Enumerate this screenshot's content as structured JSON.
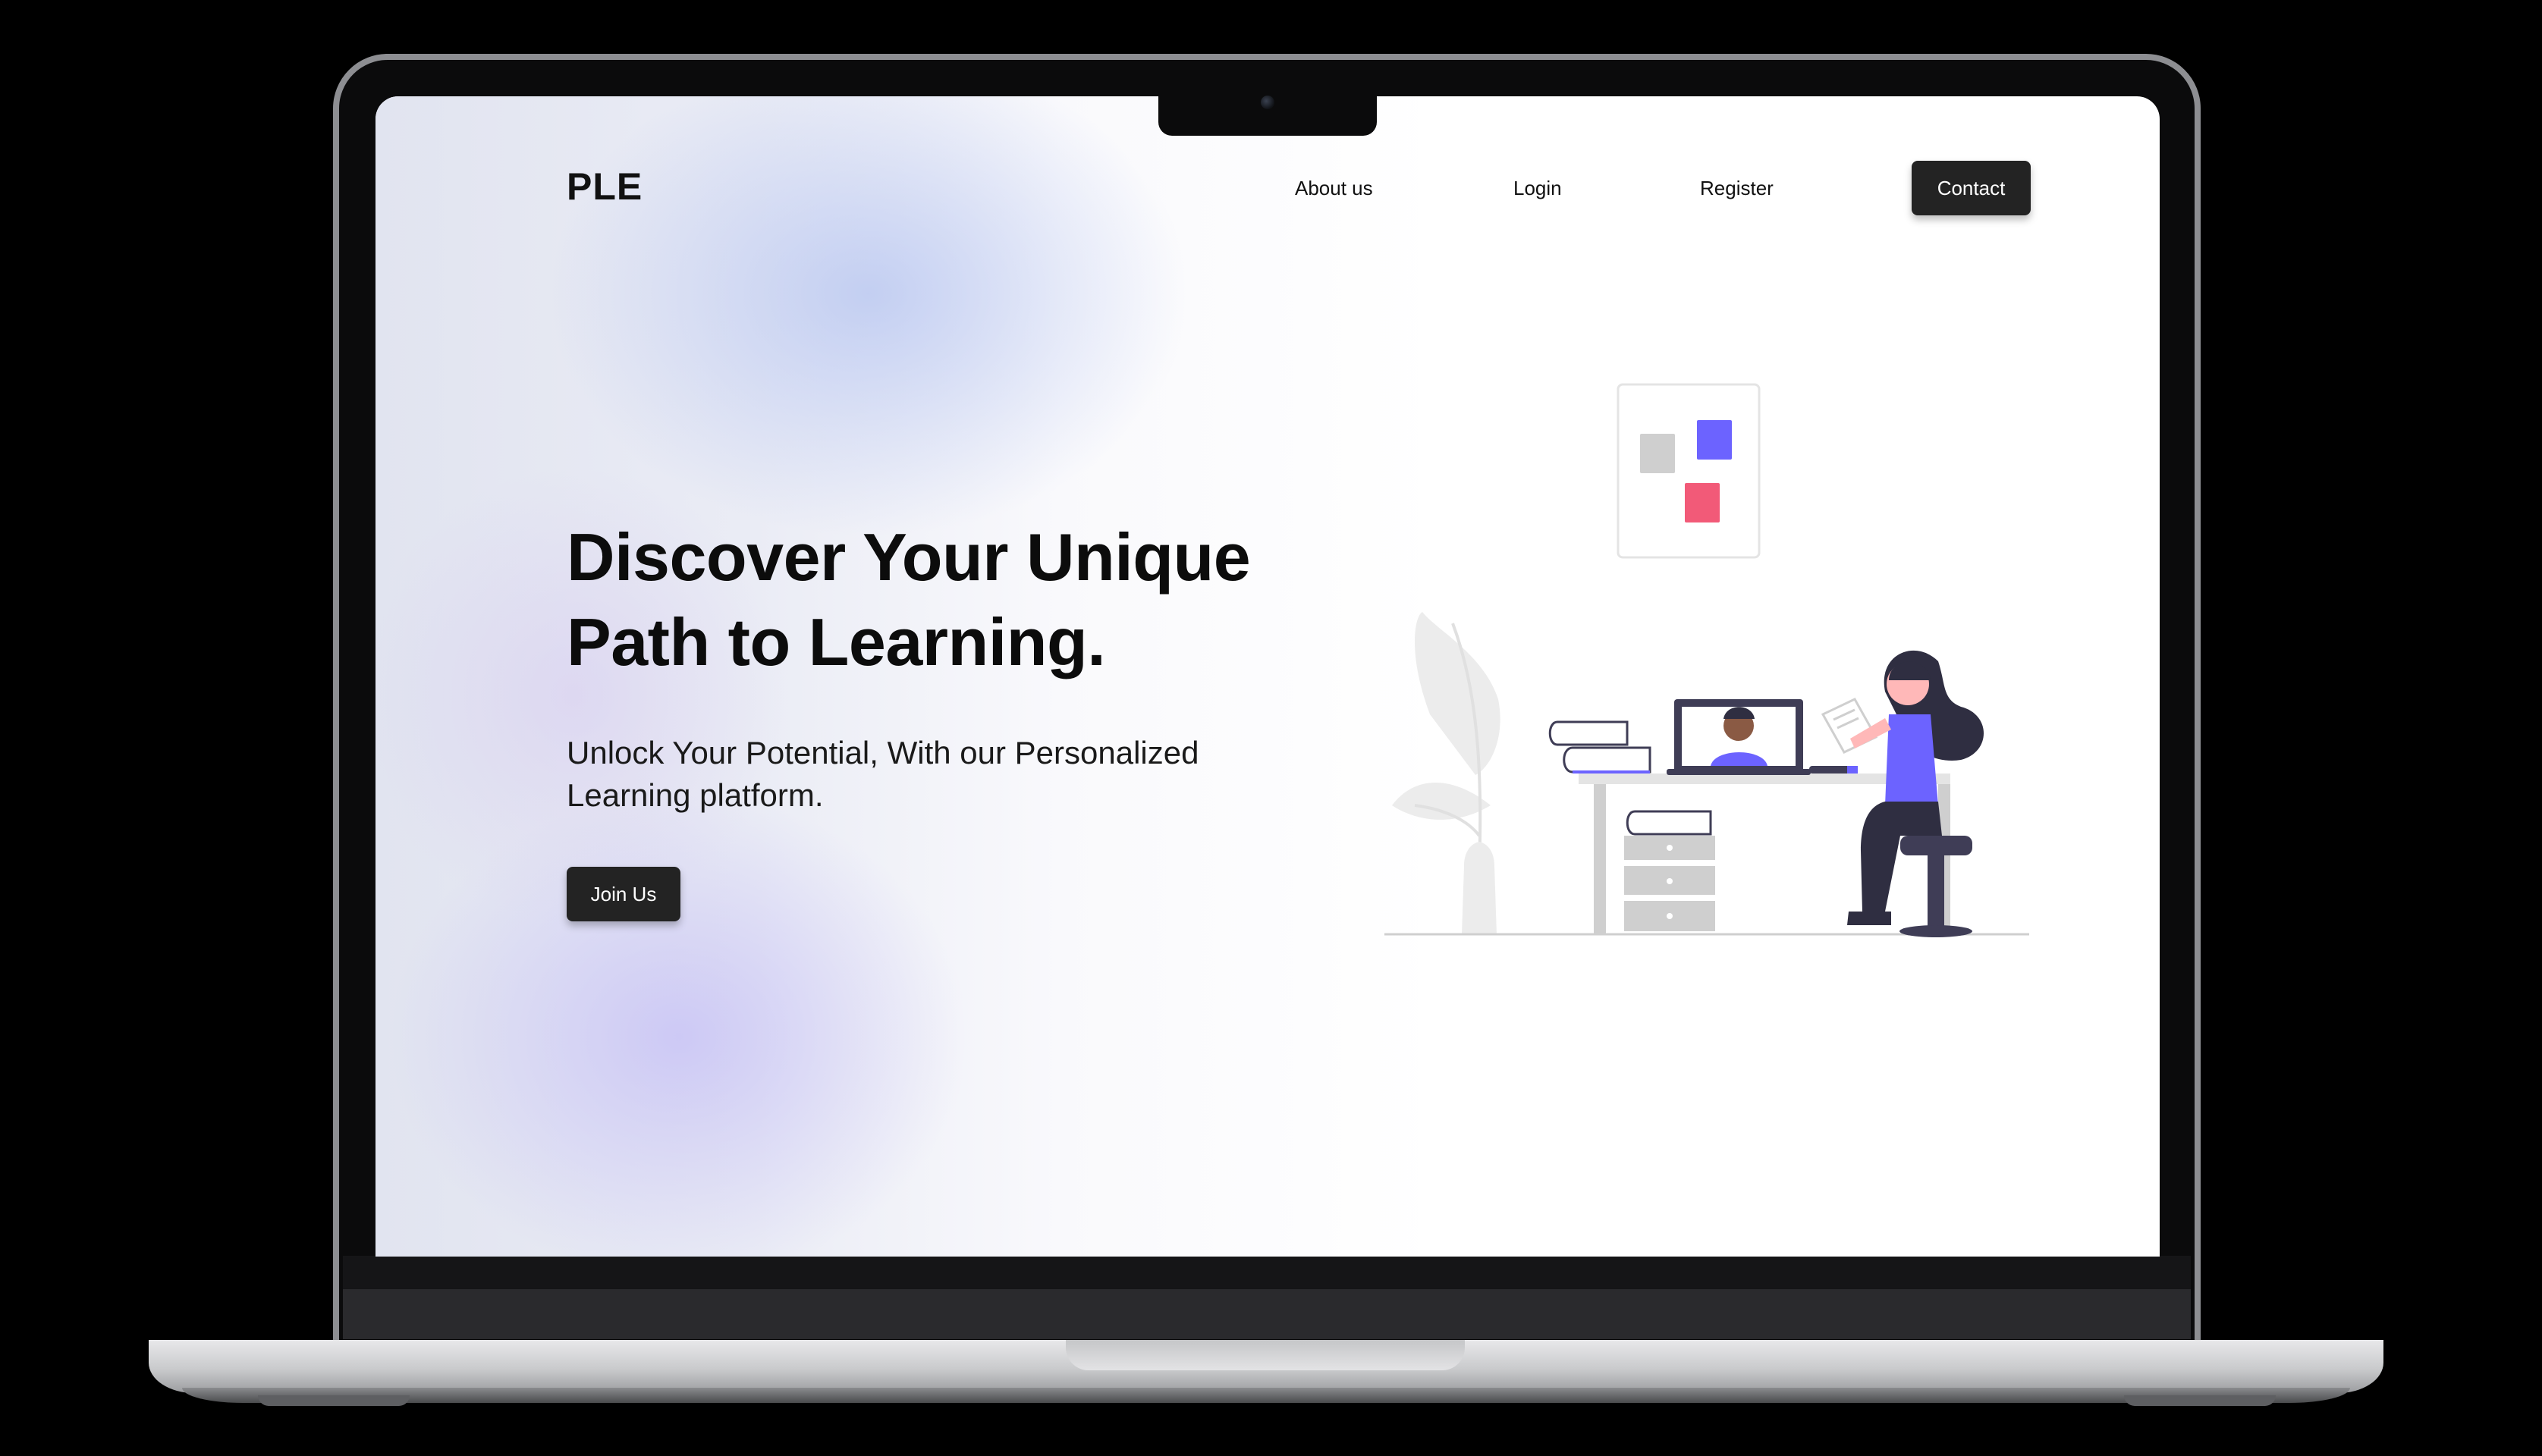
{
  "page": {
    "logo": "PLE",
    "nav": {
      "about": "About us",
      "login": "Login",
      "register": "Register",
      "contact": "Contact"
    },
    "hero": {
      "title_line1": "Discover Your Unique",
      "title_line2": "Path to Learning.",
      "subtitle_line1": "Unlock Your Potential, With our Personalized",
      "subtitle_line2": "Learning platform.",
      "cta": "Join Us"
    }
  },
  "colors": {
    "button_bg": "#232323",
    "accent_purple": "#6c63ff",
    "accent_pink": "#f25a78",
    "neutral_gray": "#cfcfcf"
  },
  "icons": [
    "camera-icon",
    "learning-illustration"
  ]
}
